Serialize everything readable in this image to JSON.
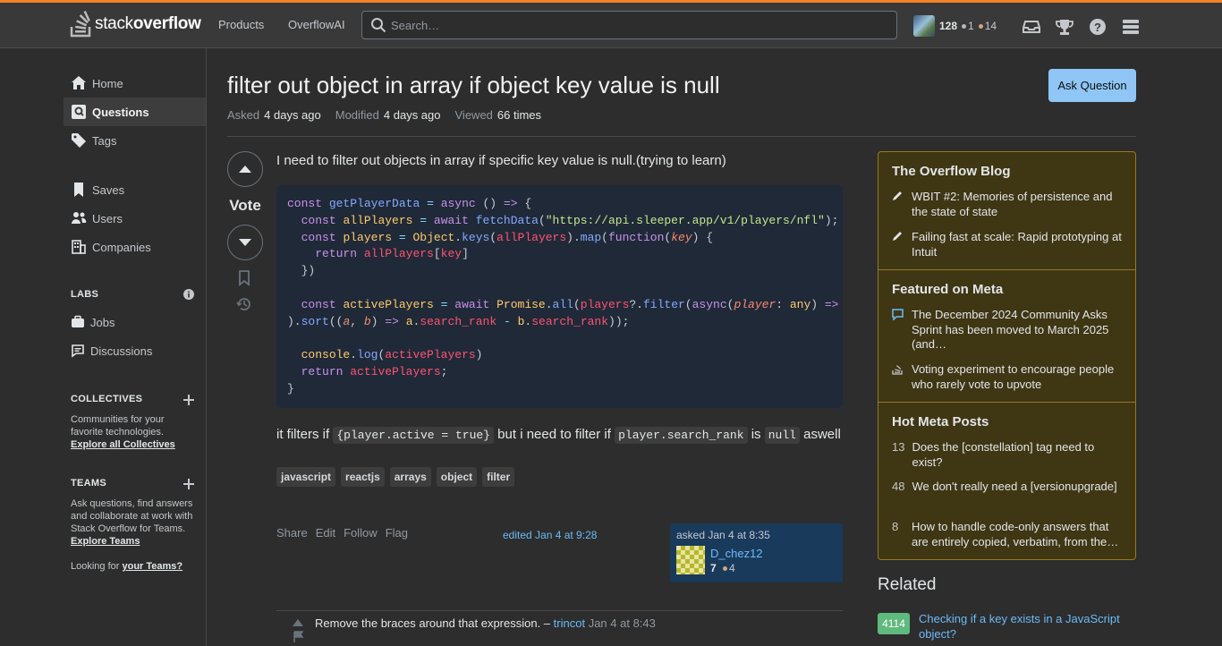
{
  "topbar": {
    "logo_text_light": "stack",
    "logo_text_bold": "overflow",
    "nav": [
      "Products",
      "OverflowAI"
    ],
    "search_placeholder": "Search…",
    "user": {
      "reputation": "128",
      "silver": "1",
      "bronze": "14"
    },
    "icons": [
      "inbox-icon",
      "achievements-icon",
      "help-icon",
      "site-switcher-icon"
    ]
  },
  "sidebar": {
    "items": [
      {
        "label": "Home",
        "icon": "home-icon"
      },
      {
        "label": "Questions",
        "icon": "questions-icon",
        "active": true
      },
      {
        "label": "Tags",
        "icon": "tag-icon"
      },
      {
        "label": "Saves",
        "icon": "bookmark-icon"
      },
      {
        "label": "Users",
        "icon": "users-icon"
      },
      {
        "label": "Companies",
        "icon": "companies-icon"
      }
    ],
    "labs_heading": "LABS",
    "labs_items": [
      {
        "label": "Jobs",
        "icon": "briefcase-icon"
      },
      {
        "label": "Discussions",
        "icon": "discussions-icon"
      }
    ],
    "collectives_heading": "COLLECTIVES",
    "collectives_text": "Communities for your favorite technologies.",
    "collectives_link": "Explore all Collectives",
    "teams_heading": "TEAMS",
    "teams_text": "Ask questions, find answers and collaborate at work with Stack Overflow for Teams.",
    "teams_link": "Explore Teams",
    "looking_text": "Looking for",
    "looking_link": "your Teams?"
  },
  "question": {
    "title": "filter out object in array if object key value is null",
    "ask_button": "Ask Question",
    "asked_label": "Asked",
    "asked_value": "4 days ago",
    "modified_label": "Modified",
    "modified_value": "4 days ago",
    "viewed_label": "Viewed",
    "viewed_value": "66 times",
    "vote_label": "Vote",
    "body_intro": "I need to filter out objects in array if specific key value is null.(trying to learn)",
    "body_after_1": "it filters if",
    "code_inline_1": "{player.active = true}",
    "body_after_2": "but i need to filter if",
    "code_inline_2": "player.search_rank",
    "body_after_3": "is",
    "code_inline_3": "null",
    "body_after_4": "aswell",
    "tags": [
      "javascript",
      "reactjs",
      "arrays",
      "object",
      "filter"
    ],
    "actions": [
      "Share",
      "Edit",
      "Follow",
      "Flag"
    ],
    "edited": "edited Jan 4 at 9:28",
    "asked_card": {
      "time": "asked Jan 4 at 8:35",
      "name": "D_chez12",
      "rep": "7",
      "bronze": "4"
    },
    "comment": {
      "text": "Remove the braces around that expression. –",
      "user": "trincot",
      "time": "Jan 4 at 8:43"
    }
  },
  "right": {
    "blog_heading": "The Overflow Blog",
    "blog_items": [
      "WBIT #2: Memories of persistence and the state of state",
      "Failing fast at scale: Rapid prototyping at Intuit"
    ],
    "meta_heading": "Featured on Meta",
    "meta_items": [
      "The December 2024 Community Asks Sprint has been moved to March 2025 (and…",
      "Voting experiment to encourage people who rarely vote to upvote"
    ],
    "hot_heading": "Hot Meta Posts",
    "hot_items": [
      {
        "count": "13",
        "text": "Does the [constellation] tag need to exist?"
      },
      {
        "count": "48",
        "text": "We don't really need a [versionupgrade]"
      },
      {
        "count": "8",
        "text": "How to handle code-only answers that are entirely copied, verbatim, from the…"
      }
    ],
    "related_heading": "Related",
    "related": [
      {
        "score": "4114",
        "title": "Checking if a key exists in a JavaScript object?"
      }
    ]
  },
  "colors": {
    "accent": "#f48225",
    "link": "#6bbbf7",
    "ask_button": "#8fc6f5",
    "blog_bg": "#3f3614",
    "blog_border": "#947b1b",
    "related_badge": "#5eba7d"
  }
}
